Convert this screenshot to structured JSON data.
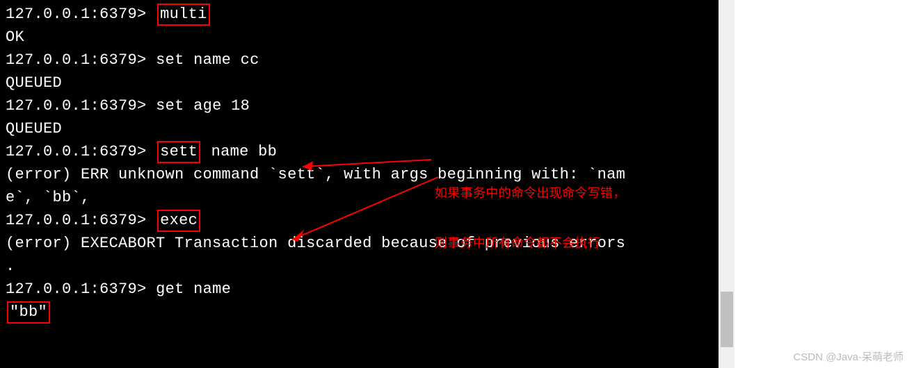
{
  "terminal": {
    "prompt": "127.0.0.1:6379>",
    "lines": {
      "l1_cmd": "multi",
      "l2_resp": "OK",
      "l3_cmd": "set name cc",
      "l4_resp": "QUEUED",
      "l5_cmd": "set age 18",
      "l6_resp": "QUEUED",
      "l7_cmd_a": "sett",
      "l7_cmd_b": " name bb",
      "l8_err": "(error) ERR unknown command `sett`, with args beginning with: `nam\ne`, `bb`,",
      "l9_cmd": "exec",
      "l10_err": "(error) EXECABORT Transaction discarded because of previous errors\n.",
      "l11_cmd": "get name",
      "l12_resp": "\"bb\""
    }
  },
  "annotation": {
    "line1": "如果事务中的命令出现命令写错，",
    "line2": "则事务中所有命令都不会执行"
  },
  "watermark": "CSDN @Java-呆萌老师"
}
